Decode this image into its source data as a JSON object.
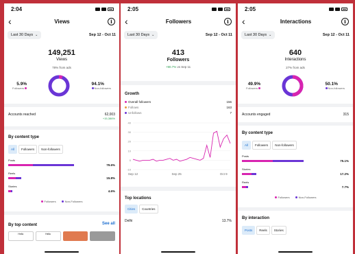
{
  "status_time_1": "2:04",
  "status_time_2": "2:05",
  "status_time_3": "2:05",
  "colors": {
    "followers": "#d824b0",
    "non_followers": "#6a35d6",
    "positive": "#2a9d4f",
    "link": "#1d6fd0"
  },
  "filter": {
    "range_label": "Last 30 Days",
    "date_range": "Sep 12 - Oct 11"
  },
  "views": {
    "title": "Views",
    "total": "149,251",
    "label": "Views",
    "ads_note": "78% from ads",
    "followers_pct": "5.9%",
    "followers_label": "Followers",
    "non_followers_pct": "94.1%",
    "non_followers_label": "Non-followers",
    "followers_fraction": 0.059,
    "accounts_reached_label": "Accounts reached",
    "accounts_reached_value": "62,003",
    "accounts_reached_change": "+15,386%",
    "content_type_title": "By content type",
    "tabs": [
      "All",
      "Followers",
      "Non-followers"
    ],
    "bars": [
      {
        "name": "Posts",
        "pct": "79.6%",
        "total": 0.796,
        "follower_share": 0.38
      },
      {
        "name": "Reels",
        "pct": "15.8%",
        "total": 0.158,
        "follower_share": 0.6
      },
      {
        "name": "Stories",
        "pct": "4.6%",
        "total": 0.046,
        "follower_share": 0.7
      }
    ],
    "legend_followers": "Followers",
    "legend_non_followers": "Non-Followers",
    "top_content_title": "By top content",
    "see_all": "See all",
    "thumbs": [
      "Hello",
      "Hello",
      "",
      ""
    ]
  },
  "followers": {
    "title": "Followers",
    "total": "413",
    "label": "Followers",
    "change": "+90.7%",
    "change_suffix": "vs Sep 11",
    "growth_title": "Growth",
    "growth_rows": [
      {
        "name": "Overall followers",
        "value": "156",
        "color": "#d824b0"
      },
      {
        "name": "Follows",
        "value": "163",
        "color": "#e79a3b"
      },
      {
        "name": "Unfollows",
        "value": "7",
        "color": "#6a35d6"
      }
    ],
    "chart_data": {
      "type": "line",
      "x": [
        "Sep 12",
        "Sep 13",
        "Sep 14",
        "Sep 15",
        "Sep 16",
        "Sep 17",
        "Sep 18",
        "Sep 19",
        "Sep 20",
        "Sep 21",
        "Sep 22",
        "Sep 23",
        "Sep 24",
        "Sep 25",
        "Sep 26",
        "Sep 27",
        "Sep 28",
        "Sep 29",
        "Sep 30",
        "Oct 1",
        "Oct 2",
        "Oct 3",
        "Oct 4",
        "Oct 5",
        "Oct 6",
        "Oct 7",
        "Oct 8",
        "Oct 9",
        "Oct 10",
        "Oct 11"
      ],
      "series": [
        {
          "values": [
            1,
            0,
            -1,
            0,
            0,
            0,
            1,
            -1,
            0,
            0,
            1,
            2,
            0,
            1,
            -1,
            0,
            1,
            3,
            2,
            1,
            0,
            2,
            16,
            3,
            29,
            31,
            14,
            23,
            27,
            18
          ]
        }
      ],
      "ylim": [
        -10,
        40
      ],
      "yticks": [
        "40",
        "30",
        "20",
        "10",
        "0",
        "-10"
      ],
      "xtick_labels": [
        "Sep 12",
        "Sep 25",
        "Oct 9"
      ],
      "xtick_index": [
        0,
        13,
        27
      ],
      "color": "#d824b0"
    },
    "locations_title": "Top locations",
    "location_tabs": [
      "Cities",
      "Countries"
    ],
    "first_city": "Delhi",
    "first_city_pct": "13.7%"
  },
  "interactions": {
    "title": "Interactions",
    "total": "640",
    "label": "Interactions",
    "ads_note": "27% from ads",
    "followers_pct": "49.9%",
    "followers_label": "Followers",
    "non_followers_pct": "50.1%",
    "non_followers_label": "Non-followers",
    "followers_fraction": 0.499,
    "engaged_label": "Accounts engaged",
    "engaged_value": "315",
    "content_type_title": "By content type",
    "tabs": [
      "All",
      "Followers",
      "Non-followers"
    ],
    "bars": [
      {
        "name": "Posts",
        "pct": "75.1%",
        "total": 0.751,
        "follower_share": 0.5
      },
      {
        "name": "Stories",
        "pct": "17.2%",
        "total": 0.172,
        "follower_share": 0.7
      },
      {
        "name": "Reels",
        "pct": "7.7%",
        "total": 0.077,
        "follower_share": 0.6
      }
    ],
    "legend_followers": "Followers",
    "legend_non_followers": "Non-Followers",
    "by_interaction_title": "By interaction",
    "interaction_tabs": [
      "Posts",
      "Reels",
      "Stories"
    ]
  }
}
